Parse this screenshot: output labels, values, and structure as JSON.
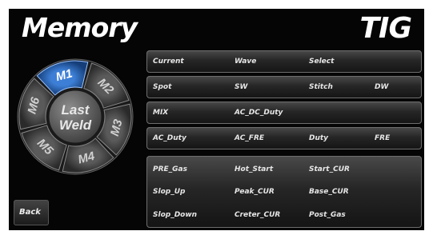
{
  "header": {
    "title": "Memory",
    "mode": "TIG"
  },
  "memory_dial": {
    "center_label_line1": "Last",
    "center_label_line2": "Weld",
    "slots": [
      {
        "label": "M1",
        "selected": true
      },
      {
        "label": "M2",
        "selected": false
      },
      {
        "label": "M3",
        "selected": false
      },
      {
        "label": "M4",
        "selected": false
      },
      {
        "label": "M5",
        "selected": false
      },
      {
        "label": "M6",
        "selected": false
      }
    ],
    "selected_color": "#1e5fb0"
  },
  "panels": {
    "p1": [
      "Current",
      "Wave",
      "Select"
    ],
    "p2": [
      "Spot",
      "SW",
      "Stitch",
      "DW"
    ],
    "p3": [
      "MIX",
      "AC_DC_Duty"
    ],
    "p4": [
      "AC_Duty",
      "AC_FRE",
      "Duty",
      "FRE"
    ],
    "p5": {
      "row1": [
        "PRE_Gas",
        "Hot_Start",
        "Start_CUR"
      ],
      "row2": [
        "Slop_Up",
        "Peak_CUR",
        "Base_CUR"
      ],
      "row3": [
        "Slop_Down",
        "Creter_CUR",
        "Post_Gas"
      ]
    }
  },
  "back_button": {
    "label": "Back"
  }
}
